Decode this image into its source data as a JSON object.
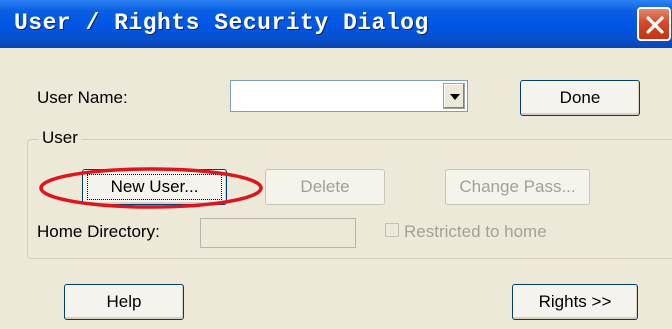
{
  "window": {
    "title": "User / Rights Security Dialog",
    "close_icon": "close-icon"
  },
  "user_name": {
    "label": "User Name:",
    "value": ""
  },
  "buttons": {
    "done": "Done",
    "new_user": "New User...",
    "delete": "Delete",
    "change_pass": "Change Pass...",
    "help": "Help",
    "rights": "Rights >>"
  },
  "user_group": {
    "title": "User",
    "home_directory_label": "Home Directory:",
    "home_directory_value": "",
    "restricted_label": "Restricted to home",
    "restricted_checked": false
  },
  "annotation": {
    "highlight_color": "#e0141c"
  },
  "colors": {
    "title_bar": "#0055e5",
    "dialog_bg": "#ece9d8",
    "disabled_text": "#a3a196"
  }
}
